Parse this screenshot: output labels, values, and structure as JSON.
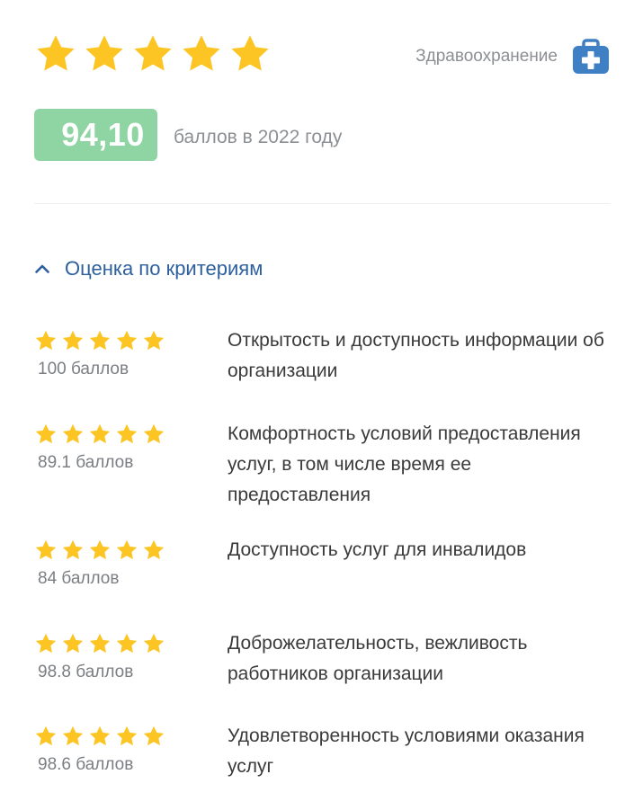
{
  "header": {
    "rating_stars": 5,
    "category_label": "Здравоохранение",
    "category_icon": "medkit-icon"
  },
  "score": {
    "value": "94,10",
    "caption": "баллов в 2022 году",
    "badge_color": "#8fd4a3"
  },
  "criteria": {
    "title": "Оценка по критериям",
    "expanded": true,
    "items": [
      {
        "stars": 5,
        "score": "100 баллов",
        "label": "Открытость и доступность информации об организации"
      },
      {
        "stars": 5,
        "score": "89.1 баллов",
        "label": "Комфортность условий предоставления услуг, в том числе время ее предоставления"
      },
      {
        "stars": 5,
        "score": "84 баллов",
        "label": "Доступность услуг для инвалидов"
      },
      {
        "stars": 5,
        "score": "98.8 баллов",
        "label": "Доброжелательность, вежливость работников организации"
      },
      {
        "stars": 5,
        "score": "98.6 баллов",
        "label": "Удовлетворенность условиями оказания услуг"
      }
    ]
  },
  "colors": {
    "star": "#fdc524",
    "accent": "#2d5f9e",
    "icon_blue": "#3f7fc4"
  }
}
